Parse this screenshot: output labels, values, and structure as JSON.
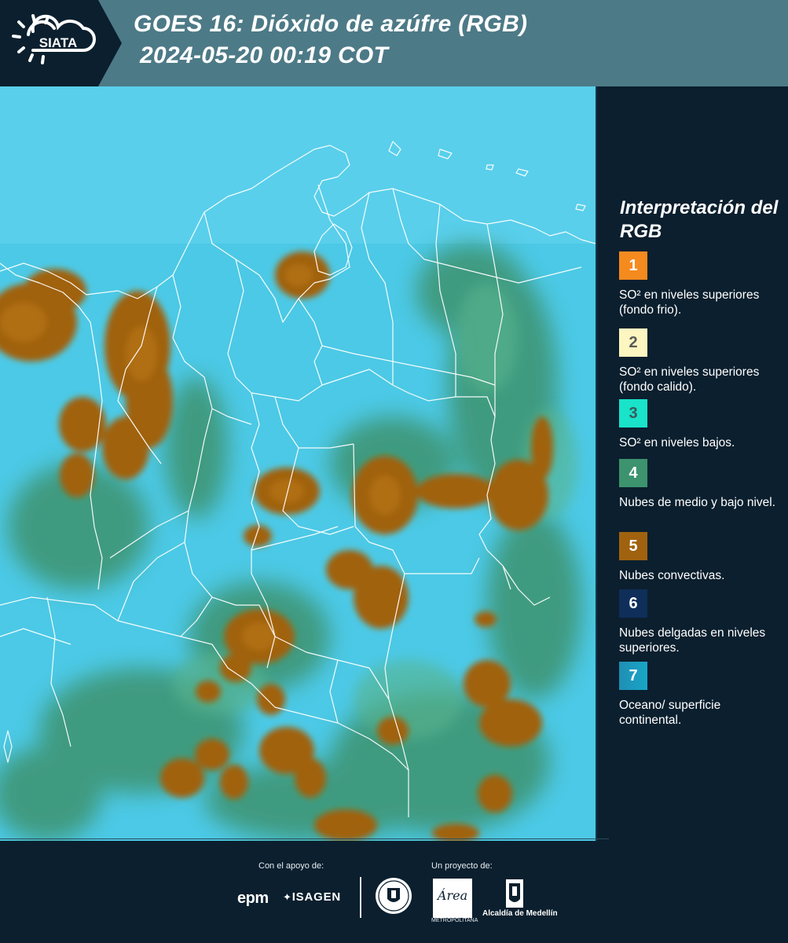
{
  "header": {
    "logo_text": "SIATA",
    "title_line1": "GOES 16: Dióxido de azúfre (RGB)",
    "title_line2": "2024-05-20 00:19 COT"
  },
  "legend": {
    "title": "Interpretación del RGB",
    "items": [
      {
        "number": "1",
        "color": "#f58a1f",
        "number_color": "#ffffff",
        "label": "SO² en niveles superiores (fondo frio)."
      },
      {
        "number": "2",
        "color": "#fdf6c0",
        "number_color": "#5a5a5a",
        "label": "SO² en niveles superiores (fondo calido)."
      },
      {
        "number": "3",
        "color": "#19e3c9",
        "number_color": "#3a5a5a",
        "label": "SO² en niveles bajos."
      },
      {
        "number": "4",
        "color": "#3c936e",
        "number_color": "#ffffff",
        "label": "Nubes de medio y bajo nivel."
      },
      {
        "number": "5",
        "color": "#a0620f",
        "number_color": "#ffffff",
        "label": "Nubes convectivas."
      },
      {
        "number": "6",
        "color": "#0f2e59",
        "number_color": "#ffffff",
        "label": "Nubes delgadas en niveles superiores."
      },
      {
        "number": "7",
        "color": "#1e8fb3",
        "number_color": "#ffffff",
        "label": "Oceano/ superficie continental."
      }
    ]
  },
  "map": {
    "colors": {
      "background": "#4cc9e6",
      "convective": "#a0620f",
      "mid_low": "#3c936e",
      "borders": "#ffffff"
    }
  },
  "footer": {
    "support_label": "Con el apoyo de:",
    "project_label": "Un proyecto de:",
    "sponsors": [
      "epm",
      "ISAGEN"
    ],
    "partners": [
      "Área Metropolitana Valle de Aburrá",
      "Alcaldía de Medellín"
    ],
    "area_logo_text": "Área",
    "area_subtext": "METROPOLITANA",
    "alcaldia_label": "Alcaldía de Medellín"
  }
}
